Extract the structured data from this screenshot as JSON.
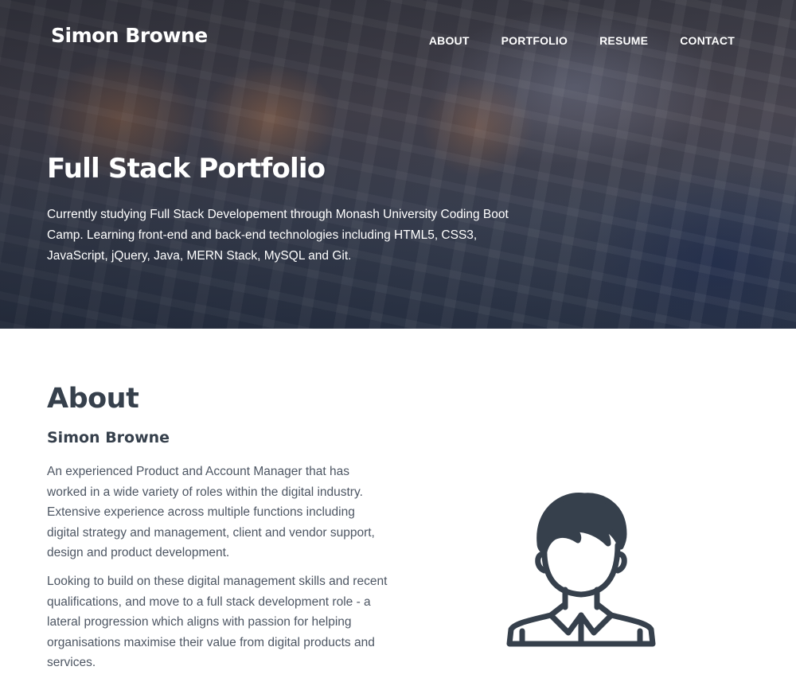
{
  "header": {
    "brand": "Simon Browne",
    "nav": [
      "ABOUT",
      "PORTFOLIO",
      "RESUME",
      "CONTACT"
    ]
  },
  "hero": {
    "title": "Full Stack Portfolio",
    "lines": [
      "Currently studying Full Stack Developement through Monash University Coding Boot",
      "Camp. Learning front-end and back-end technologies including HTML5, CSS3,",
      "JavaScript, jQuery, Java, MERN Stack, MySQL and Git."
    ]
  },
  "about": {
    "title": "About",
    "subtitle": "Simon Browne",
    "paragraph1": [
      "An experienced Product and Account Manager that has",
      "worked in a wide variety of roles within the digital industry.",
      "Extensive experience across multiple functions including",
      "digital strategy and management, client and vendor support,",
      "design and product development."
    ],
    "paragraph2": [
      "Looking to build on these digital management skills and recent",
      "qualifications, and move to a full stack development role - a",
      "lateral progression which aligns with passion for helping",
      "organisations maximise their value from digital products and",
      "services."
    ],
    "avatar_icon": "person-avatar-icon",
    "icon_color": "#36404c"
  },
  "colors": {
    "heading": "#36404c",
    "body_text": "#4d5663",
    "hero_text": "#ffffff"
  }
}
